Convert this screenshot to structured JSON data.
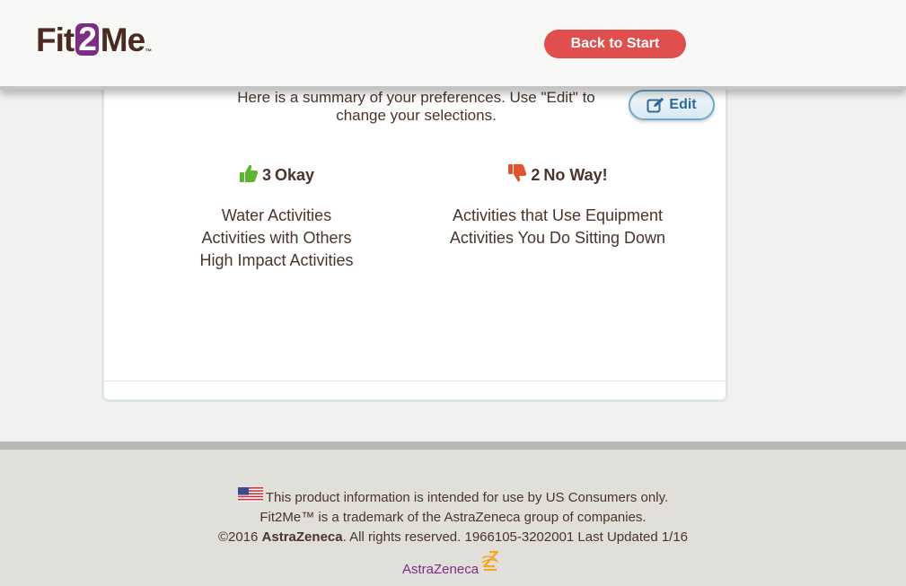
{
  "header": {
    "logo": {
      "part1": "Fit",
      "part2": "2",
      "part3": "Me"
    },
    "back_button_label": "Back to Start"
  },
  "summary": {
    "intro_text": "Here is a summary of your preferences. Use \"Edit\" to change your selections.",
    "edit_button_label": "Edit"
  },
  "okay": {
    "count": "3",
    "label": "Okay",
    "items": [
      "Water Activities",
      "Activities with Others",
      "High Impact Activities"
    ],
    "icon": "thumbs-up-icon",
    "color": "#5cb531"
  },
  "no_way": {
    "count": "2",
    "label": "No Way!",
    "items": [
      "Activities that Use Equipment",
      "Activities You Do Sitting Down"
    ],
    "icon": "thumbs-down-icon",
    "color": "#e0532e"
  },
  "footer": {
    "line1": "This product information is intended for use by US Consumers only.",
    "line2": "Fit2Me™ is a trademark of the AstraZeneca group of companies.",
    "line3_prefix": "©2016 ",
    "line3_brand": "AstraZeneca",
    "line3_suffix": ". All rights reserved. 1966105-3202001 Last Updated 1/16",
    "logo_text": "AstraZeneca"
  },
  "colors": {
    "brand_purple": "#7d2d83",
    "brand_brown": "#4a2a22",
    "back_button_red": "#e04e4e",
    "edit_blue": "#2a6a9c"
  }
}
